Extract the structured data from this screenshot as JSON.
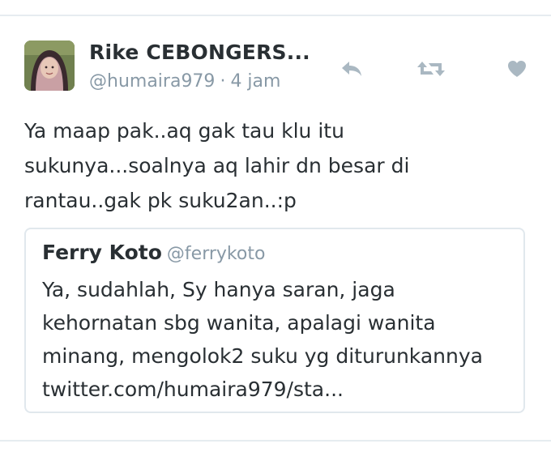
{
  "tweet": {
    "display_name": "Rike CEBONGERS...",
    "handle": "@humaira979",
    "separator": "·",
    "time": "4 jam",
    "text_lines": [
      "Ya maap pak..aq gak tau klu itu",
      "sukunya...soalnya aq lahir dn besar di",
      "rantau..gak pk suku2an..:p"
    ]
  },
  "actions": {
    "reply_icon": "reply-icon",
    "retweet_icon": "retweet-icon",
    "like_icon": "heart-icon"
  },
  "quoted_tweet": {
    "name": "Ferry Koto",
    "handle": "@ferrykoto",
    "text_lines": [
      "Ya, sudahlah, Sy hanya saran, jaga",
      "kehornatan sbg wanita, apalagi wanita",
      "minang, mengolok2 suku yg diturunkannya",
      "twitter.com/humaira979/sta..."
    ]
  },
  "colors": {
    "text": "#292f33",
    "muted": "#8899a6",
    "icon": "#aab8c2",
    "border": "#e1e8ed"
  }
}
